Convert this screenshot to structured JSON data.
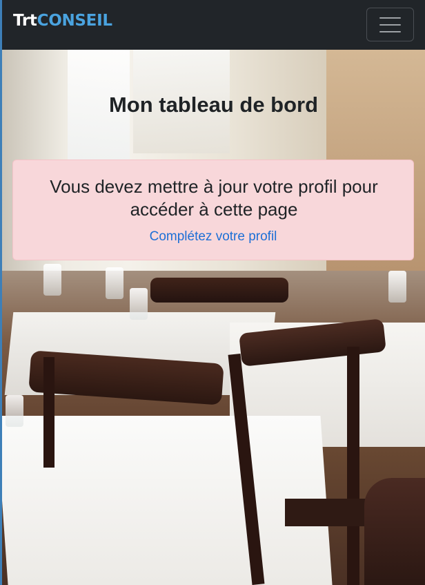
{
  "navbar": {
    "brand_part1": "Trt",
    "brand_part2": "CONSEIL",
    "toggler_icon": "hamburger-menu-icon"
  },
  "page": {
    "title": "Mon tableau de bord"
  },
  "alert": {
    "message": "Vous devez mettre à jour votre profil pour accéder à cette page",
    "link_label": "Complétez votre profil"
  },
  "colors": {
    "navbar_bg": "#212529",
    "brand_accent": "#4aa3df",
    "alert_bg": "#f8d7da",
    "link": "#1d6fd6"
  }
}
